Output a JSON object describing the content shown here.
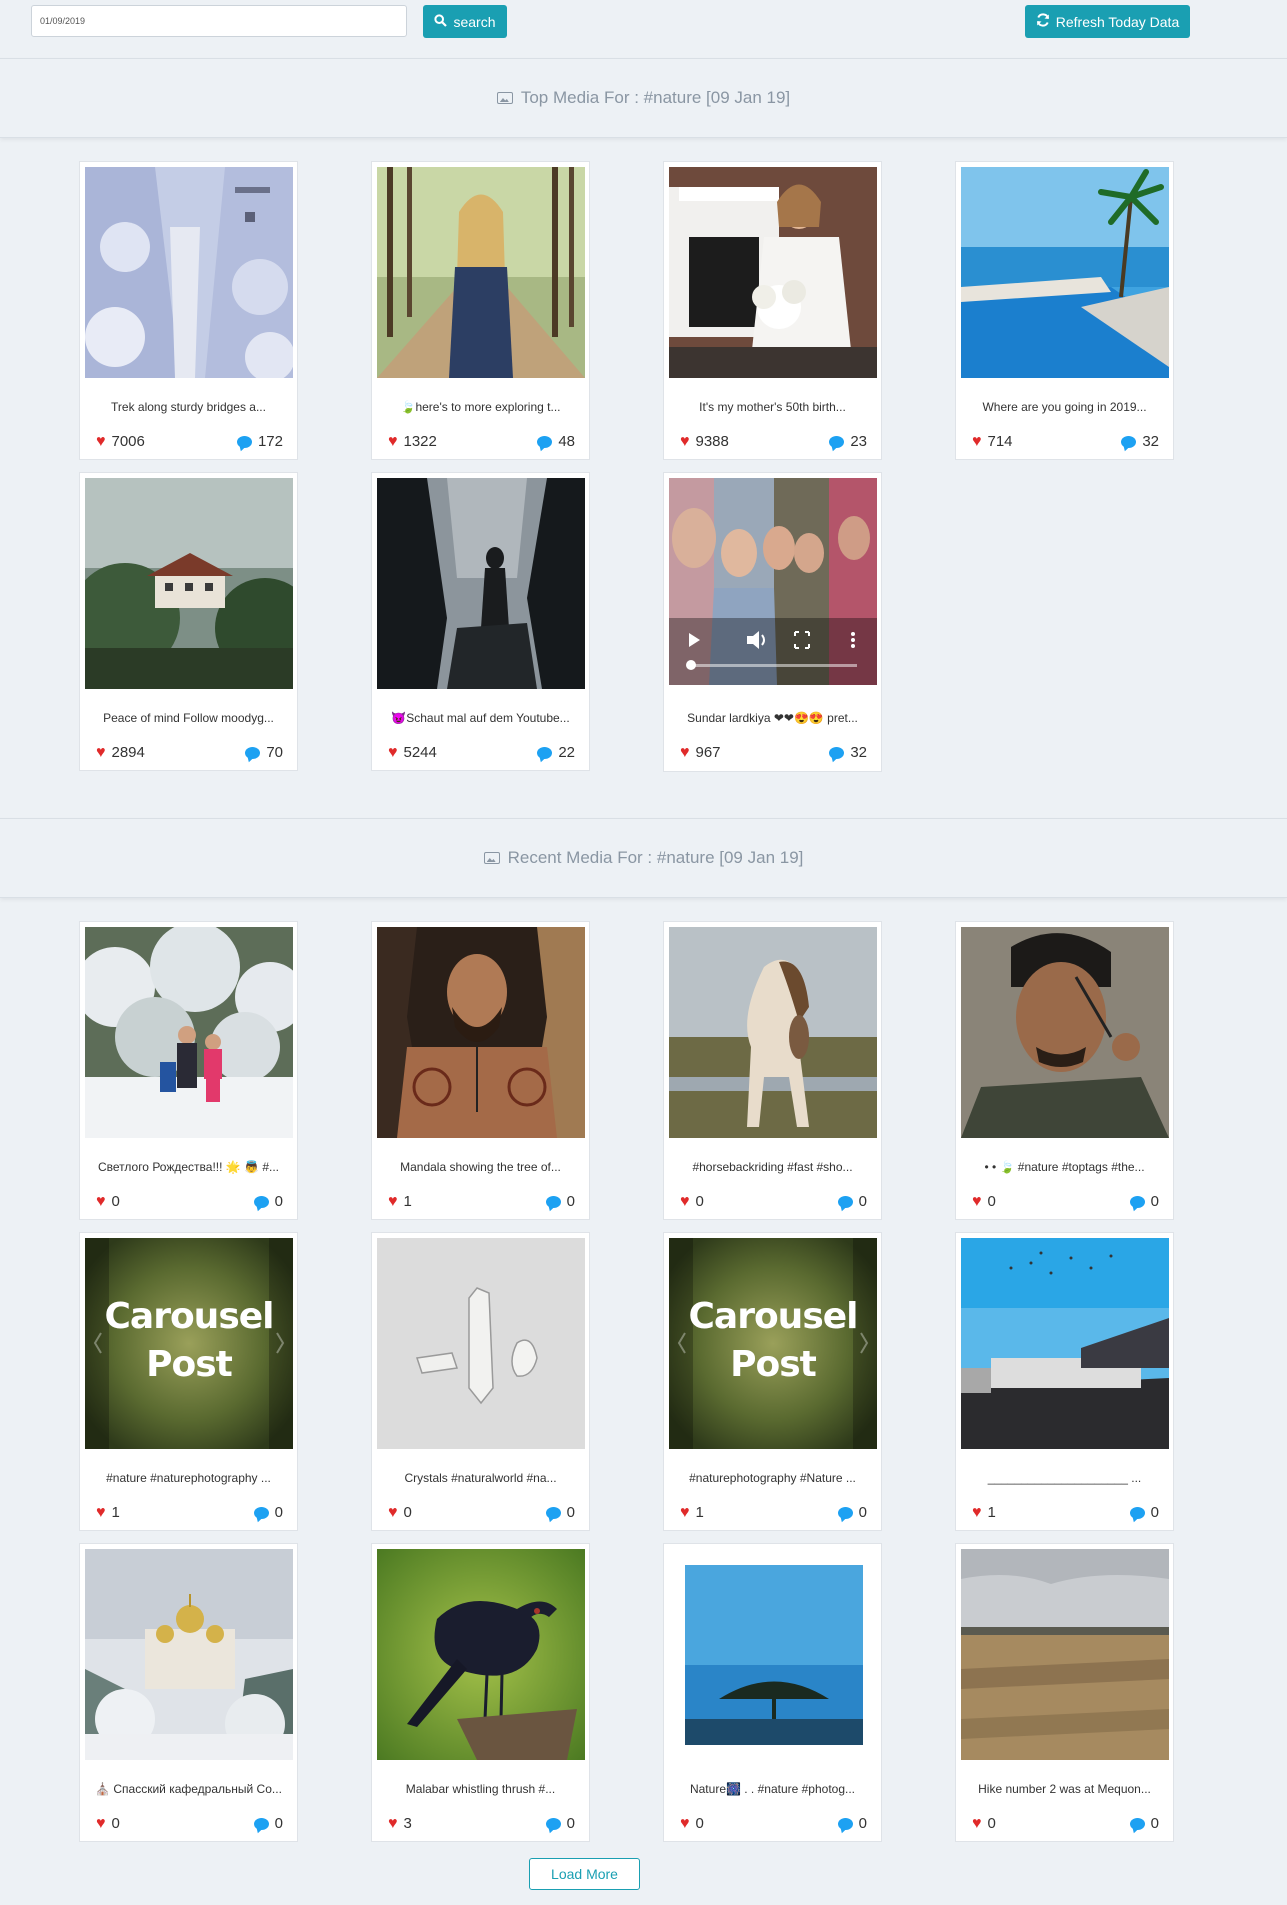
{
  "toolbar": {
    "date_value": "01/09/2019",
    "search_label": "search",
    "refresh_label": "Refresh Today Data",
    "accent_color": "#1a9fb2"
  },
  "top_section": {
    "title": "Top Media For : #nature [09 Jan 19]",
    "items": [
      {
        "caption": "Trek along sturdy bridges a...",
        "likes": "7006",
        "comments": "172"
      },
      {
        "caption": "🍃here's to more exploring t...",
        "likes": "1322",
        "comments": "48"
      },
      {
        "caption": "It's my mother's 50th birth...",
        "likes": "9388",
        "comments": "23"
      },
      {
        "caption": "Where are you going in 2019...",
        "likes": "714",
        "comments": "32"
      },
      {
        "caption": "Peace of mind Follow moodyg...",
        "likes": "2894",
        "comments": "70"
      },
      {
        "caption": "😈Schaut mal auf dem Youtube...",
        "likes": "5244",
        "comments": "22"
      },
      {
        "caption": "Sundar lardkiya ❤❤😍😍 pret...",
        "likes": "967",
        "comments": "32"
      }
    ]
  },
  "recent_section": {
    "title": "Recent Media For : #nature [09 Jan 19]",
    "carousel_label_1": "Carousel",
    "carousel_label_2": "Post",
    "items": [
      {
        "caption": "Светлого Рождества!!! 🌟 👼 #...",
        "likes": "0",
        "comments": "0"
      },
      {
        "caption": "Mandala showing the tree of...",
        "likes": "1",
        "comments": "0"
      },
      {
        "caption": "#horsebackriding #fast #sho...",
        "likes": "0",
        "comments": "0"
      },
      {
        "caption": "• • 🍃 #nature #toptags #the...",
        "likes": "0",
        "comments": "0"
      },
      {
        "caption": "#nature #naturephotography ...",
        "likes": "1",
        "comments": "0"
      },
      {
        "caption": "Crystals #naturalworld #na...",
        "likes": "0",
        "comments": "0"
      },
      {
        "caption": "#naturephotography #Nature ...",
        "likes": "1",
        "comments": "0"
      },
      {
        "caption": "_____________________ ...",
        "likes": "1",
        "comments": "0"
      },
      {
        "caption": "⛪ Спасский кафедральный Со...",
        "likes": "0",
        "comments": "0"
      },
      {
        "caption": "Malabar whistling thrush #...",
        "likes": "3",
        "comments": "0"
      },
      {
        "caption": "Nature🎆 . . #nature #photog...",
        "likes": "0",
        "comments": "0"
      },
      {
        "caption": "Hike number 2 was at Mequon...",
        "likes": "0",
        "comments": "0"
      }
    ]
  },
  "load_more_label": "Load More",
  "icons": {
    "heart": "heart-icon",
    "comment": "comment-icon",
    "search": "search-icon",
    "refresh": "refresh-icon",
    "image": "image-icon"
  }
}
